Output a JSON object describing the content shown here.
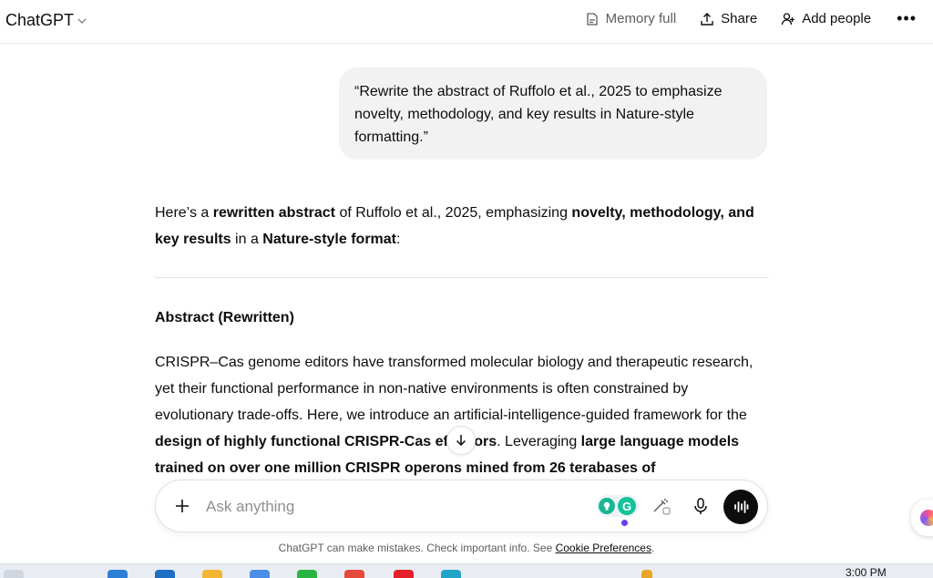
{
  "header": {
    "model_label": "ChatGPT",
    "memory_label": "Memory full",
    "share_label": "Share",
    "add_people_label": "Add people",
    "more_label": "•••"
  },
  "user_message": "“Rewrite the abstract of Ruffolo et al., 2025 to emphasize novelty, methodology, and key results in Nature-style formatting.”",
  "assistant": {
    "intro": {
      "t1": "Here’s a ",
      "b1": "rewritten abstract",
      "t2": " of Ruffolo et al., 2025, emphasizing ",
      "b2": "novelty, methodology, and key results",
      "t3": " in a ",
      "b3": "Nature-style format",
      "t4": ":"
    },
    "section_title": "Abstract (Rewritten)",
    "body": {
      "t1": "CRISPR–Cas genome editors have transformed molecular biology and therapeutic research, yet their functional performance in non-native environments is often constrained by evolutionary trade-offs. Here, we introduce an artificial-intelligence-guided framework for the ",
      "b1": "design of highly functional CRISPR-Cas effectors",
      "t2": ". Leveraging ",
      "b2": "large language models trained on over one million CRISPR operons mined from 26 terabases of"
    }
  },
  "composer": {
    "placeholder": "Ask anything"
  },
  "footer": {
    "disclaimer": "ChatGPT can make mistakes. Check important info. See ",
    "link": "Cookie Preferences",
    "end": "."
  },
  "taskbar": {
    "time": "3:00 PM"
  },
  "colors": {
    "bubble_bg": "#f2f2f2",
    "voice_button": "#0d0d0d",
    "grammarly": "#15c39a"
  },
  "icons": {
    "model_chevron": "chevron-down-icon",
    "memory": "memory-icon",
    "share": "share-upload-icon",
    "add_people": "add-person-icon",
    "scroll": "arrow-down-icon",
    "plus": "plus-icon",
    "mic": "microphone-icon",
    "voice": "voice-waveform-icon"
  }
}
